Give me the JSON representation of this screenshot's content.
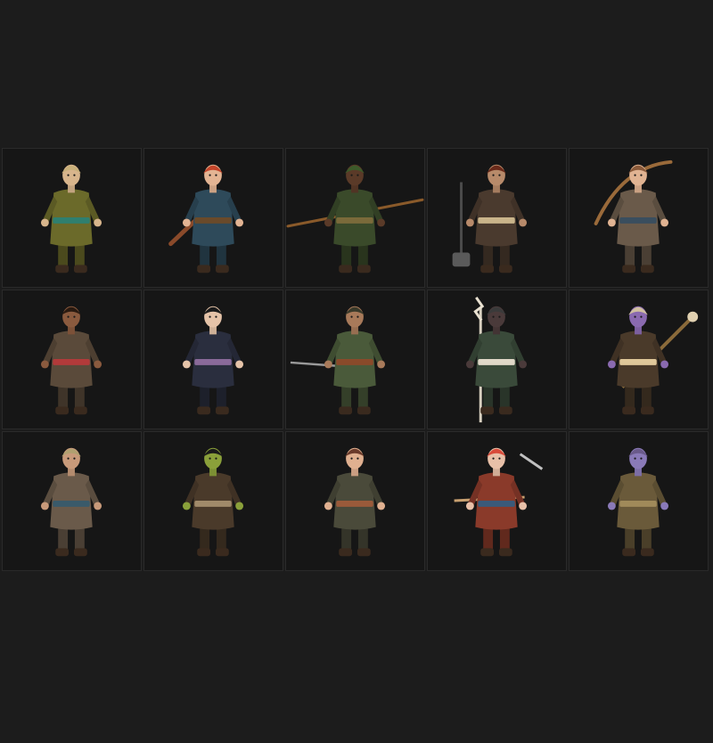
{
  "colors": {
    "background": "#1c1c1c",
    "tile_background": "#161616",
    "tile_border": "#2a2a2a"
  },
  "gallery": {
    "tiles": [
      {
        "id": "monk",
        "skin": "#d8b58c",
        "cloth": "#6b6a2a",
        "accent": "#2f7f6f",
        "hair": "#c9b07a",
        "prop": "none"
      },
      {
        "id": "red-haired-elf",
        "skin": "#e3b493",
        "cloth": "#2e4a5a",
        "accent": "#6a4a2a",
        "hair": "#c4452a",
        "prop": "club"
      },
      {
        "id": "hooded-archer",
        "skin": "#5a3a28",
        "cloth": "#3a4a2a",
        "accent": "#7a6a3a",
        "hair": "#3d5a2a",
        "prop": "bow-horizontal"
      },
      {
        "id": "half-orc-warhammer",
        "skin": "#b78a6a",
        "cloth": "#4a3a2e",
        "accent": "#c9b48a",
        "hair": "#6a2a1a",
        "prop": "hammer"
      },
      {
        "id": "bow-ranger",
        "skin": "#e0b392",
        "cloth": "#6a5a4a",
        "accent": "#3a4e5e",
        "hair": "#8a5a3a",
        "prop": "bow-arc"
      },
      {
        "id": "robed-monk",
        "skin": "#8a5a3e",
        "cloth": "#5a4a3a",
        "accent": "#b23a3a",
        "hair": "#2a1a10",
        "prop": "none"
      },
      {
        "id": "noble-vest",
        "skin": "#e5c3a8",
        "cloth": "#2a2e3e",
        "accent": "#8a6a9a",
        "hair": "#1a1a1a",
        "prop": "none"
      },
      {
        "id": "crouching-rogue",
        "skin": "#a87a5a",
        "cloth": "#4a5a3a",
        "accent": "#8a4a2a",
        "hair": "#3a3a2a",
        "prop": "sword-left"
      },
      {
        "id": "staff-mage",
        "skin": "#4a3a3a",
        "cloth": "#3a4a3a",
        "accent": "#e0d8c8",
        "hair": "#3a3a3a",
        "prop": "staff-bolt"
      },
      {
        "id": "purple-tiefling",
        "skin": "#8a6ab0",
        "cloth": "#4a3a2a",
        "accent": "#e0c89a",
        "hair": "#d0c0a0",
        "prop": "staff-diagonal"
      },
      {
        "id": "masked-scout",
        "skin": "#c89a7a",
        "cloth": "#6a5a4a",
        "accent": "#3a5a6a",
        "hair": "#b0a070",
        "prop": "none"
      },
      {
        "id": "green-orc",
        "skin": "#8aa03a",
        "cloth": "#4a3a2a",
        "accent": "#a08a6a",
        "hair": "#1a1a1a",
        "prop": "none"
      },
      {
        "id": "cloaked-wanderer",
        "skin": "#e0b090",
        "cloth": "#4a4a3a",
        "accent": "#9a5a3a",
        "hair": "#6a3a2a",
        "prop": "none"
      },
      {
        "id": "dual-blade-fighter",
        "skin": "#e8c0a8",
        "cloth": "#8a3a2a",
        "accent": "#3a5a7a",
        "hair": "#d84a3a",
        "prop": "blades"
      },
      {
        "id": "purple-goblin",
        "skin": "#8a7ab8",
        "cloth": "#6a5a3a",
        "accent": "#a08a5a",
        "hair": "#6a5a8a",
        "prop": "none"
      }
    ]
  }
}
